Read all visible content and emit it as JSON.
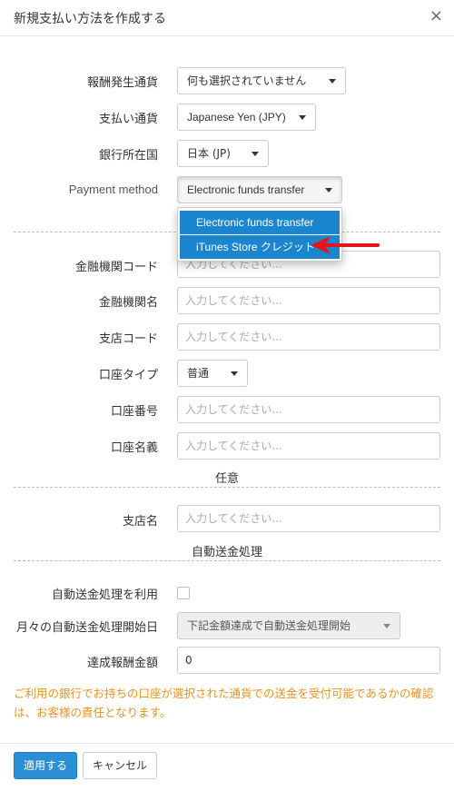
{
  "dialog": {
    "title": "新規支払い方法を作成する",
    "close": "×"
  },
  "fields": {
    "reward_currency": {
      "label": "報酬発生通貨",
      "value": "何も選択されていません"
    },
    "payment_currency": {
      "label": "支払い通貨",
      "value": "Japanese Yen (JPY)"
    },
    "bank_country": {
      "label": "銀行所在国",
      "value": "日本 (JP)"
    },
    "payment_method": {
      "label": "Payment method",
      "value": "Electronic funds transfer",
      "options": [
        "Electronic funds transfer",
        "iTunes Store クレジット"
      ]
    },
    "bank_code": {
      "label": "金融機関コード",
      "placeholder": "入力してください..."
    },
    "bank_name": {
      "label": "金融機関名",
      "placeholder": "入力してください..."
    },
    "branch_code": {
      "label": "支店コード",
      "placeholder": "入力してください..."
    },
    "account_type": {
      "label": "口座タイプ",
      "value": "普通"
    },
    "account_number": {
      "label": "口座番号",
      "placeholder": "入力してください..."
    },
    "account_holder": {
      "label": "口座名義",
      "placeholder": "入力してください..."
    },
    "branch_name": {
      "label": "支店名",
      "placeholder": "入力してください..."
    },
    "auto_transfer_use": {
      "label": "自動送金処理を利用"
    },
    "auto_transfer_start": {
      "label": "月々の自動送金処理開始日",
      "value": "下記金額達成で自動送金処理開始"
    },
    "threshold_amount": {
      "label": "達成報酬金額",
      "value": "0"
    }
  },
  "sections": {
    "optional": "任意",
    "auto_transfer": "自動送金処理"
  },
  "note": "ご利用の銀行でお持ちの口座が選択された通貨での送金を受付可能であるかの確認は、お客様の責任となります。",
  "buttons": {
    "apply": "適用する",
    "cancel": "キャンセル"
  },
  "colors": {
    "primary": "#2b8fd6",
    "dropdown_highlight": "#1a86d0",
    "note": "#e69522",
    "annotation_arrow": "#e8141b"
  },
  "icons": {
    "caret": "caret-down-icon",
    "close": "close-icon",
    "arrow": "red-arrow-annotation"
  }
}
